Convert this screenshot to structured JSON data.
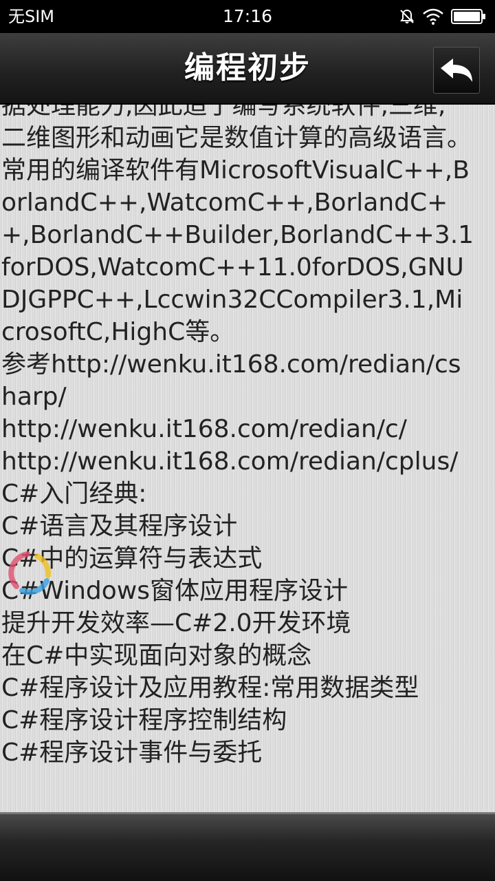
{
  "status_bar": {
    "carrier": "无SIM",
    "time": "17:16",
    "icons": [
      "mute-bell-icon",
      "wifi-icon",
      "battery-icon"
    ]
  },
  "header": {
    "title": "编程初步",
    "back_icon": "back-arrow-icon"
  },
  "content": {
    "text": "据处理能力,因此适于编写系统软件,三维,\n二维图形和动画它是数值计算的高级语言。\n常用的编译软件有MicrosoftVisualC++,BorlandC++,WatcomC++,BorlandC++,BorlandC++Builder,BorlandC++3.1forDOS,WatcomC++11.0forDOS,GNUDJGPPC++,Lccwin32CCompiler3.1,MicrosoftC,HighC等。\n参考http://wenku.it168.com/redian/csharp/\nhttp://wenku.it168.com/redian/c/\nhttp://wenku.it168.com/redian/cplus/\nC#入门经典:\nC#语言及其程序设计\nC#中的运算符与表达式\nC#Windows窗体应用程序设计\n提升开发效率—C#2.0开发环境\n在C#中实现面向对象的概念\nC#程序设计及应用教程:常用数据类型\nC#程序设计程序控制结构\nC#程序设计事件与委托"
  },
  "colors": {
    "status_bg": "#000000",
    "title_bar": "#2a2a2a",
    "content_bg": "#dcdcdc",
    "text": "#222222",
    "spinner_red": "#e05070",
    "spinner_blue": "#3aa0e0",
    "spinner_yellow": "#f0c020"
  }
}
